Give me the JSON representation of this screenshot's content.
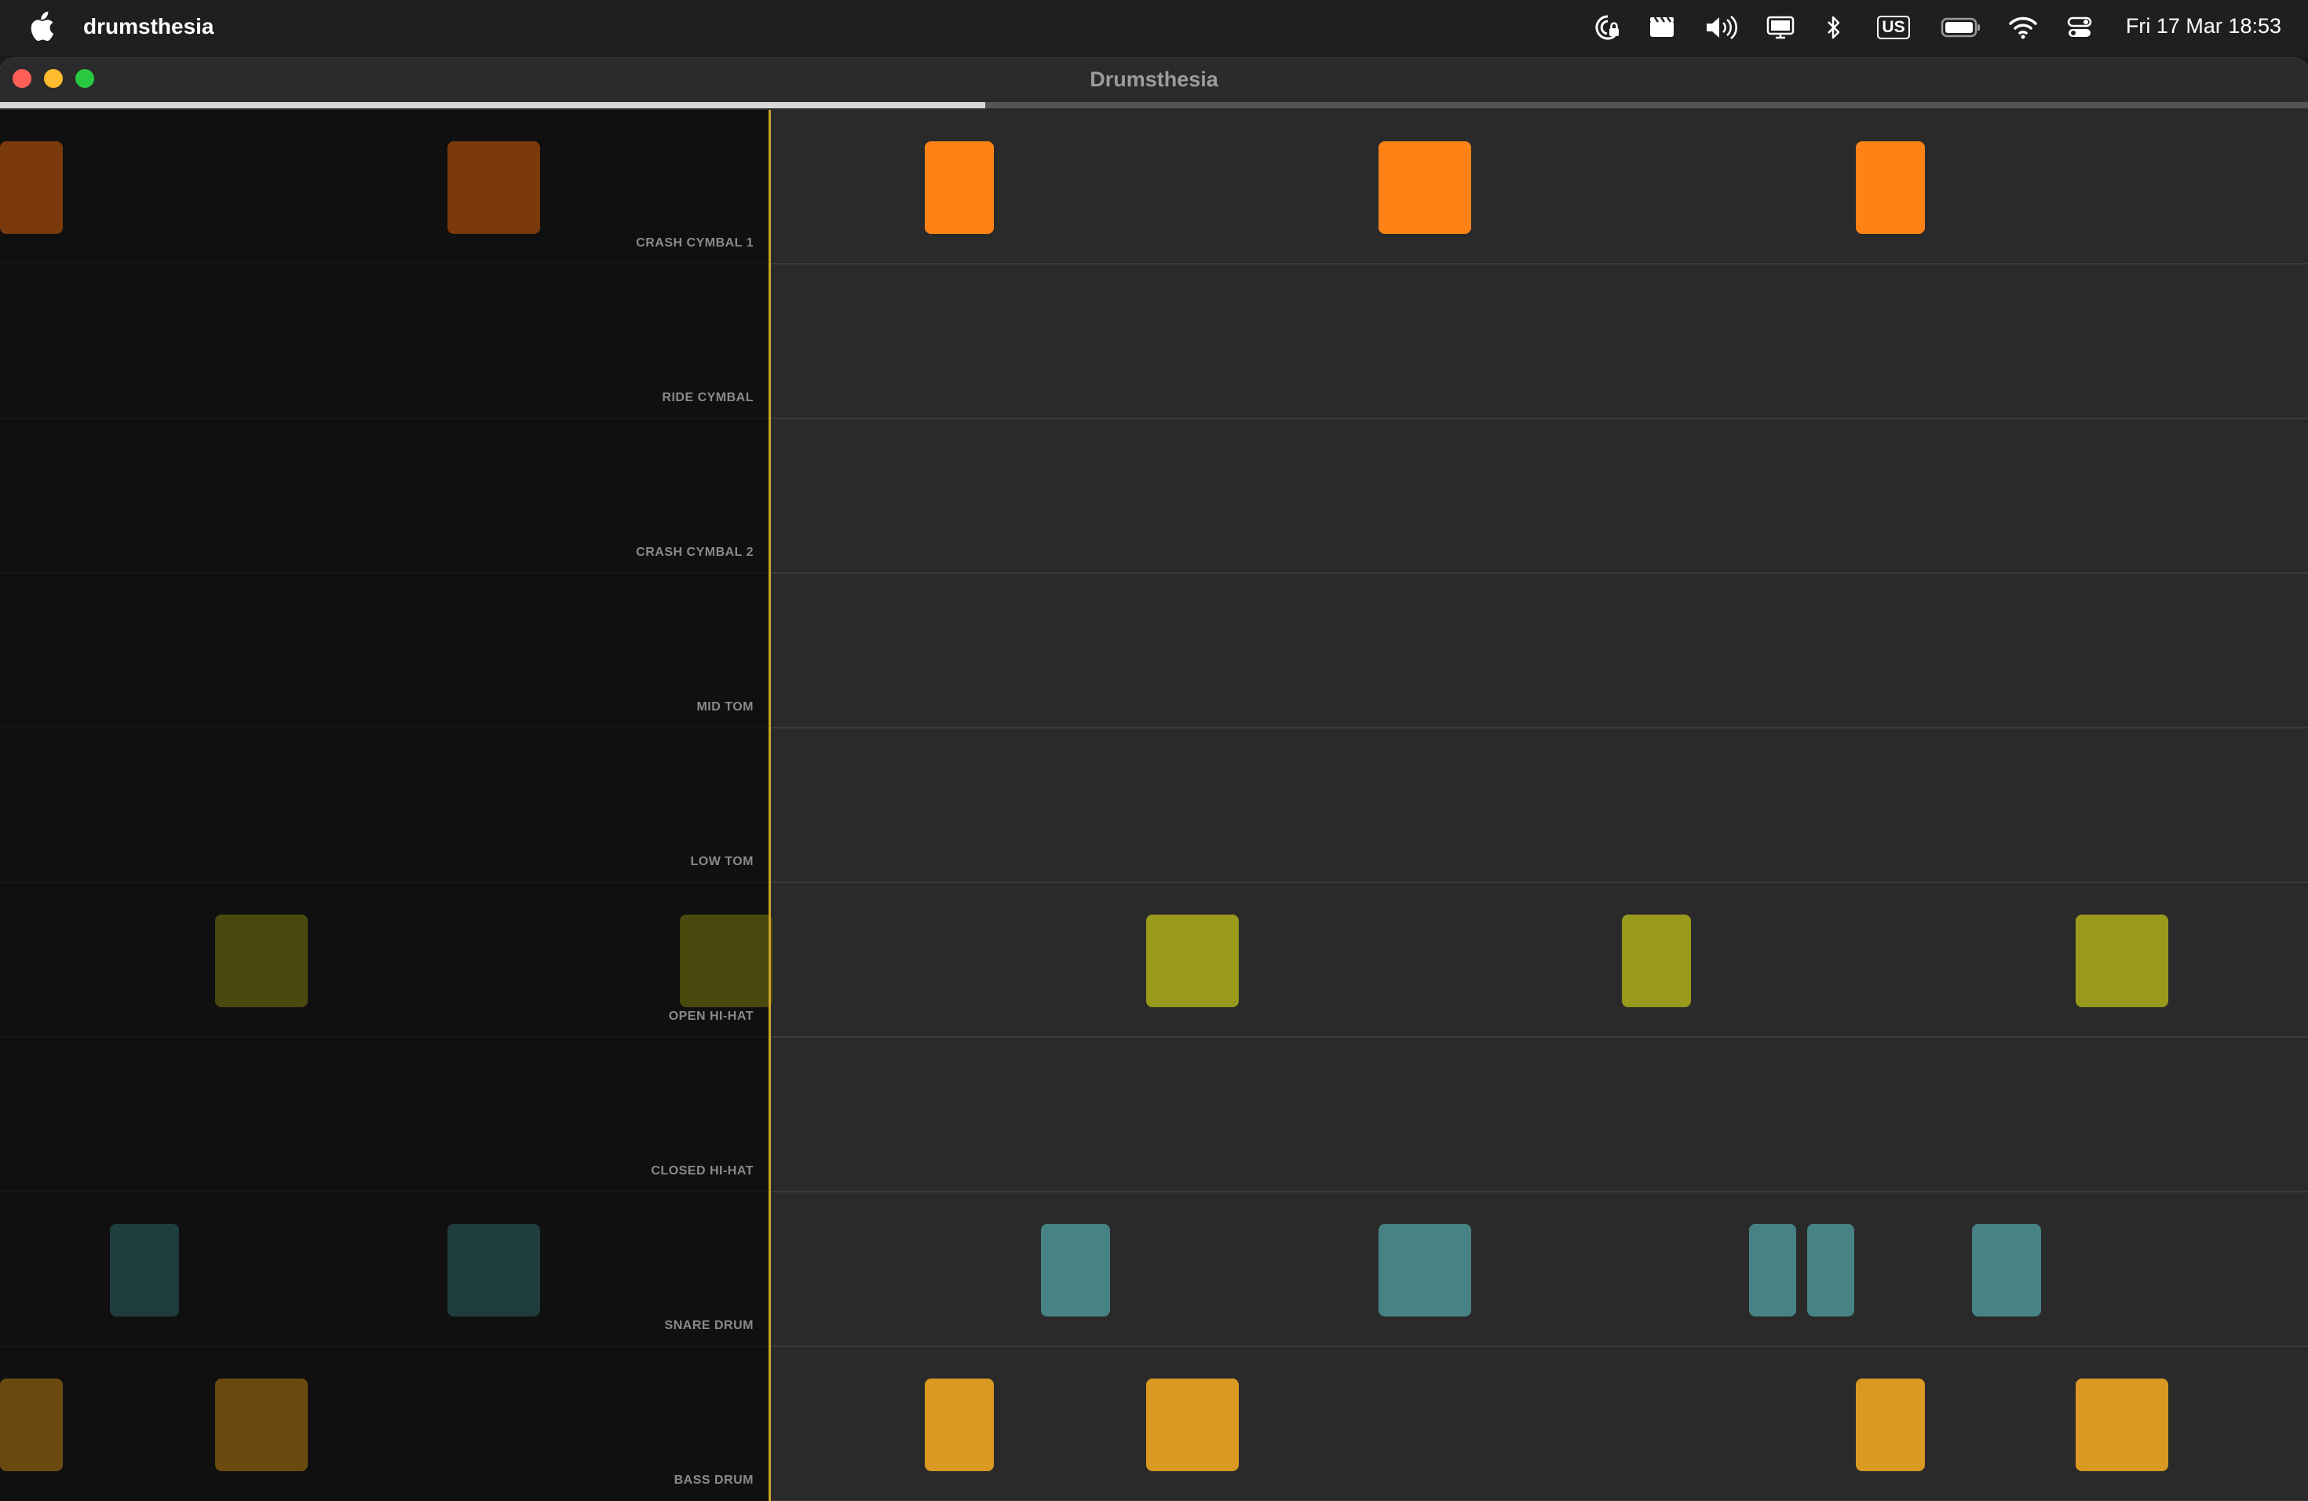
{
  "menubar": {
    "app_name": "drumsthesia",
    "keyboard_layout": "US",
    "clock": "Fri 17 Mar  18:53",
    "icons": [
      "apple-icon",
      "screen-lock-icon",
      "clapperboard-icon",
      "volume-icon",
      "display-icon",
      "bluetooth-icon",
      "keyboard-layout-icon",
      "battery-icon",
      "wifi-icon",
      "control-center-icon"
    ]
  },
  "window": {
    "title": "Drumsthesia",
    "playback_progress": 0.427,
    "traffic_lights": {
      "close": "#ff5f57",
      "minimize": "#febc2e",
      "zoom": "#28c840"
    }
  },
  "lanes": [
    {
      "label": "CRASH CYMBAL 1",
      "color": "#ff8217",
      "played_color": "#7a3a0c"
    },
    {
      "label": "RIDE CYMBAL",
      "color": "#ff8217",
      "played_color": "#7a3a0c"
    },
    {
      "label": "CRASH CYMBAL 2",
      "color": "#ff8217",
      "played_color": "#7a3a0c"
    },
    {
      "label": "MID TOM",
      "color": "#ff8217",
      "played_color": "#7a3a0c"
    },
    {
      "label": "LOW TOM",
      "color": "#ff8217",
      "played_color": "#7a3a0c"
    },
    {
      "label": "OPEN HI-HAT",
      "color": "#999a1c",
      "played_color": "#4a4a0e"
    },
    {
      "label": "CLOSED HI-HAT",
      "color": "#999a1c",
      "played_color": "#4a4a0e"
    },
    {
      "label": "SNARE DRUM",
      "color": "#478285",
      "played_color": "#1f3d3e"
    },
    {
      "label": "BASS DRUM",
      "color": "#d99922",
      "played_color": "#6b4a10"
    }
  ],
  "colors": {
    "background": "#2a2a2a",
    "played_overlay": "#0c0c0c",
    "playhead": "#c9a227"
  }
}
